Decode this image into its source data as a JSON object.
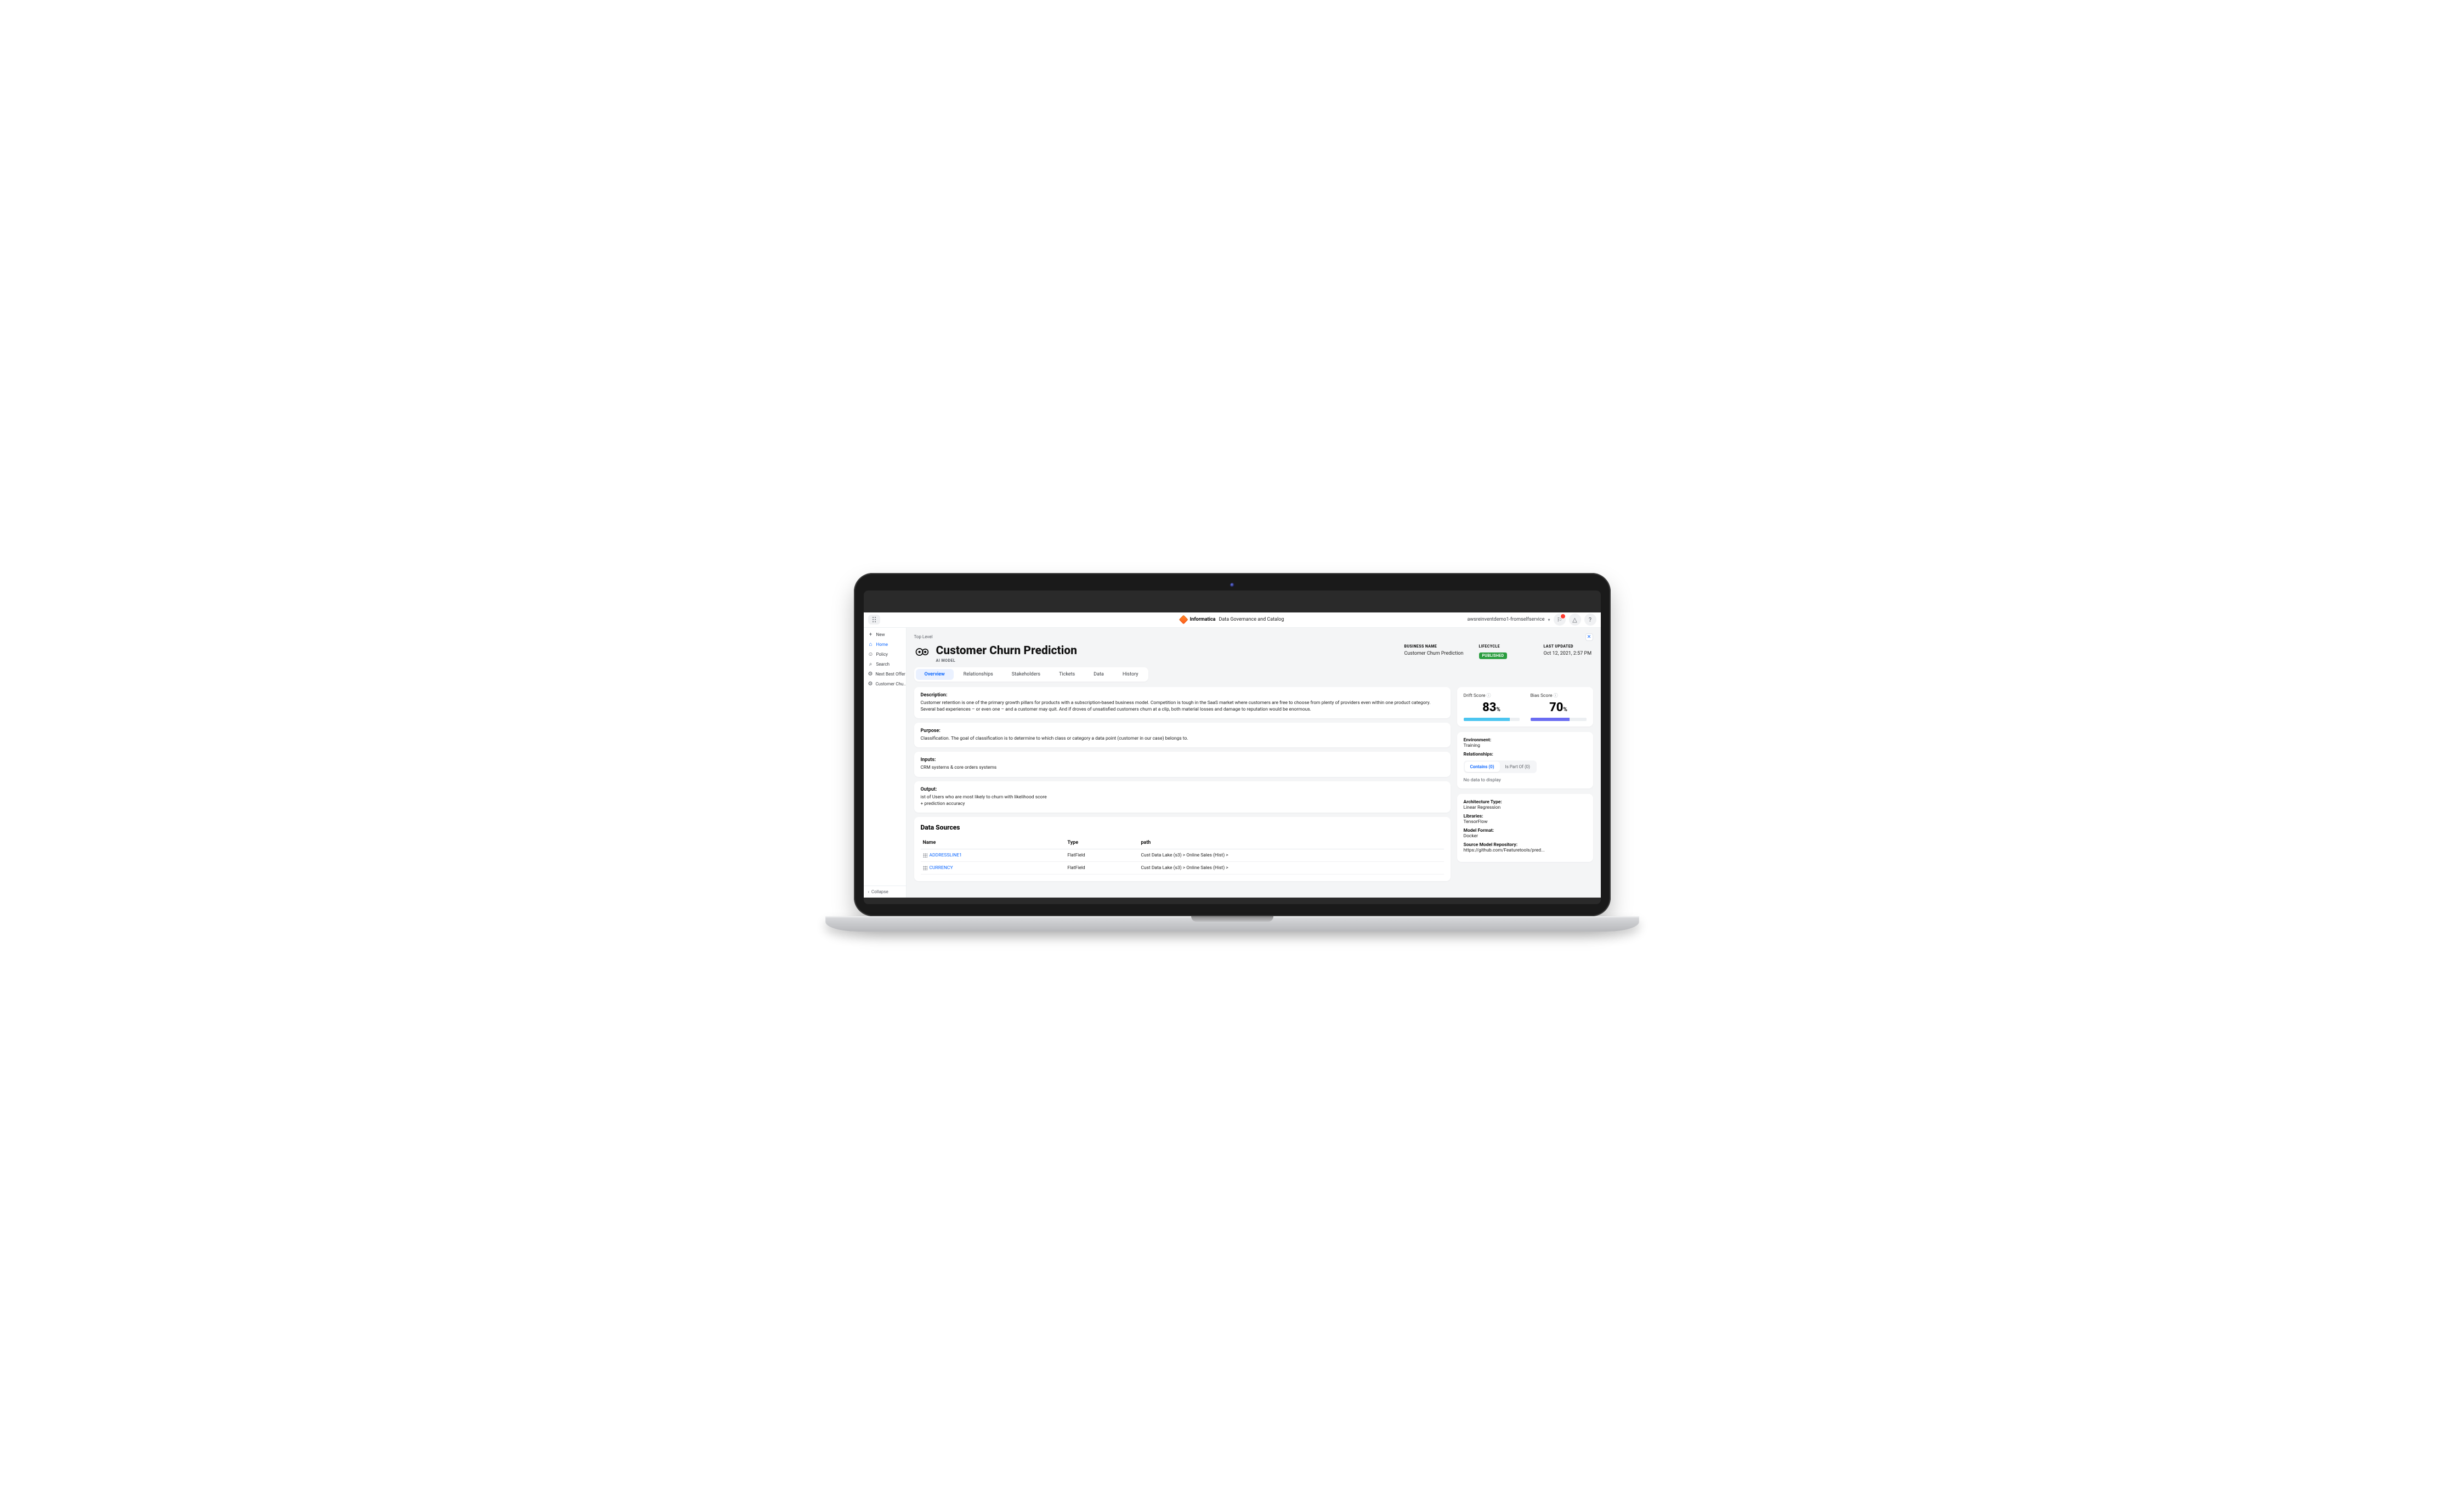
{
  "topbar": {
    "brand": "Informatica",
    "product": "Data Governance and Catalog",
    "account": "awsreinventdemo1-fromselfservice"
  },
  "sidebar": {
    "items": [
      {
        "label": "New",
        "icon": "+"
      },
      {
        "label": "Home",
        "icon": "⌂",
        "active": true
      },
      {
        "label": "Policy",
        "icon": "☺"
      },
      {
        "label": "Search",
        "icon": "⌕"
      },
      {
        "label": "Next Best Offer",
        "icon": "⚙"
      },
      {
        "label": "Customer Chu...",
        "icon": "⚙"
      }
    ],
    "collapse": "Collapse"
  },
  "crumb": "Top Level",
  "page": {
    "title": "Customer Churn Prediction",
    "subtype": "AI Model",
    "business_name_label": "Business Name",
    "business_name": "Customer Churn Prediction",
    "lifecycle_label": "Lifecycle",
    "lifecycle": "Published",
    "updated_label": "Last Updated",
    "updated": "Oct 12, 2021, 2:57 PM"
  },
  "tabs": [
    "Overview",
    "Relationships",
    "Stakeholders",
    "Tickets",
    "Data",
    "History"
  ],
  "cards": {
    "description": {
      "title": "Description:",
      "body": "Customer retention is one of the primary growth pillars for products with a subscription-based business model. Competition is tough in the SaaS market where customers are free to choose from plenty of providers even within one product category. Several bad experiences – or even one – and a customer may quit. And if droves of unsatisfied customers churn at a clip, both material losses and damage to reputation would be enormous."
    },
    "purpose": {
      "title": "Purpose:",
      "body": "Classification. The goal of classification is to determine to which class or category a data point (customer in our case) belongs to."
    },
    "inputs": {
      "title": "Inputs:",
      "body": "CRM systems & core orders systems"
    },
    "output": {
      "title": "Output:",
      "body": "ist of Users who are most likely to churn with likelihood score\n+ prediction accuracy"
    }
  },
  "data_sources": {
    "title": "Data Sources",
    "headers": [
      "Name",
      "Type",
      "path"
    ],
    "rows": [
      {
        "name": "ADDRESSLINE1",
        "type": "FlatField",
        "path": "Cust Data Lake (s3) > Online Sales (Hist) >"
      },
      {
        "name": "CURRENCY",
        "type": "FlatField",
        "path": "Cust Data Lake (s3) > Online Sales (Hist) >"
      }
    ]
  },
  "scores": {
    "drift": {
      "label": "Drift Score",
      "value": 83,
      "pct": 83,
      "color": "#4cc5f0"
    },
    "bias": {
      "label": "Bias Score",
      "value": 70,
      "pct": 70,
      "color": "#6a6cf2"
    }
  },
  "side_panel": {
    "environment": {
      "label": "Environment:",
      "value": "Training"
    },
    "relationships_label": "Relationships:",
    "rel_tabs": {
      "contains": "Contains (0)",
      "ispart": "Is Part Of (0)"
    },
    "nodata": "No data to display",
    "arch": {
      "label": "Architecture Type:",
      "value": "Linear Regression"
    },
    "libs": {
      "label": "Libraries:",
      "value": "TensorFlow"
    },
    "format": {
      "label": "Model Format:",
      "value": "Docker"
    },
    "repo": {
      "label": "Source Model Repository:",
      "value": "https://github.com/Featuretools/pred..."
    }
  }
}
